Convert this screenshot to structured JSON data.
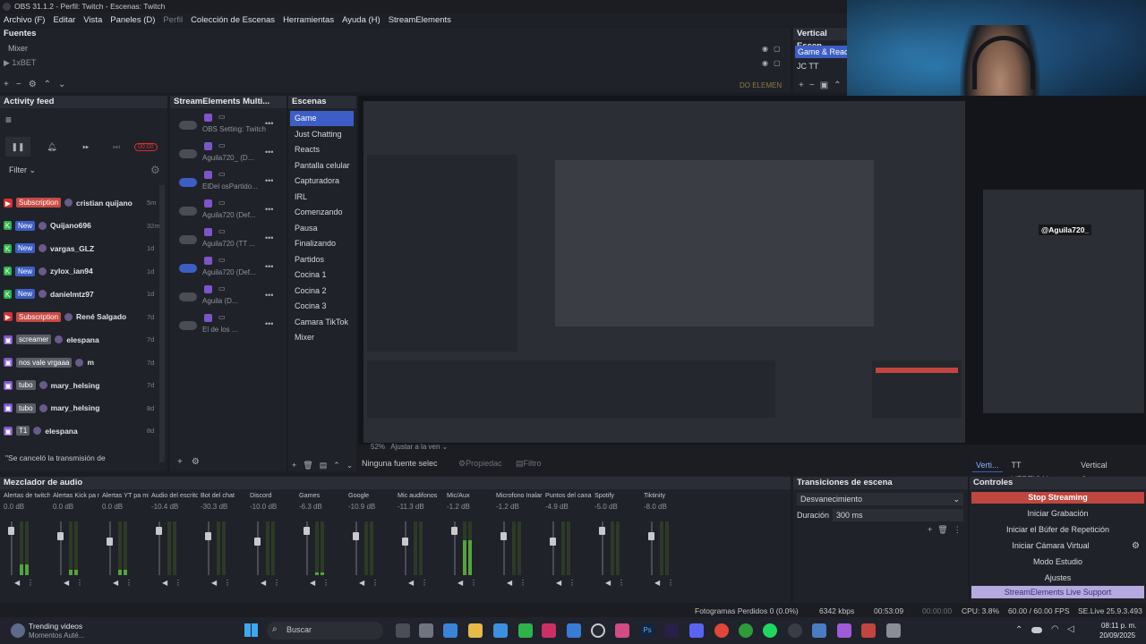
{
  "window": {
    "title": "OBS 31.1.2 - Perfil: Twitch - Escenas: Twitch"
  },
  "menu": [
    "Archivo (F)",
    "Editar",
    "Vista",
    "Paneles (D)",
    "Perfil",
    "Colección de Escenas",
    "Herramientas",
    "Ayuda (H)",
    "StreamElements"
  ],
  "sources": {
    "title": "Fuentes",
    "items": [
      "Mixer",
      "1xBET"
    ]
  },
  "vertical": {
    "title": "Vertical Escen",
    "items": [
      "Game & Reacts",
      "JC TT"
    ],
    "overlay_label": "DO ELEMEN"
  },
  "activity": {
    "title": "Activity feed",
    "filter_label": "Filter",
    "timer": "00:00",
    "rows": [
      {
        "tag": "Subscription",
        "tag_type": "sub",
        "name": "cristian quijano",
        "time": "5m"
      },
      {
        "tag": "New",
        "tag_type": "new",
        "platform": "kick",
        "name": "Quijano696",
        "time": "32m"
      },
      {
        "tag": "New",
        "tag_type": "new",
        "platform": "kick",
        "name": "vargas_GLZ",
        "time": "1d"
      },
      {
        "tag": "New",
        "tag_type": "new",
        "platform": "kick",
        "name": "zylox_ian94",
        "time": "1d"
      },
      {
        "tag": "New",
        "tag_type": "new",
        "platform": "kick",
        "name": "danielmtz97",
        "time": "1d"
      },
      {
        "tag": "Subscription",
        "tag_type": "sub",
        "name": "René Salgado",
        "time": "7d"
      },
      {
        "tag": "screamer",
        "tag_type": "gray",
        "name": "elespana",
        "time": "7d"
      },
      {
        "tag": "nos vale vrgaaa",
        "tag_type": "gray",
        "name": "m",
        "time": "7d"
      },
      {
        "tag": "tubo",
        "tag_type": "gray",
        "name": "mary_helsing",
        "time": "7d"
      },
      {
        "tag": "tubo",
        "tag_type": "gray",
        "name": "mary_helsing",
        "time": "8d"
      },
      {
        "tag": "T1",
        "tag_type": "gray",
        "name": "elespana",
        "time": "8d"
      }
    ],
    "footer": "\"Se canceló la transmisión de"
  },
  "se_multi": {
    "title": "StreamElements Multi...",
    "rows": [
      {
        "label": "OBS Setting: Twitch",
        "on": false
      },
      {
        "label": "Aguila720_ (D...",
        "on": false
      },
      {
        "label": "ElDel osPartido...",
        "on": true
      },
      {
        "label": "Aguila720 (Def...",
        "on": false
      },
      {
        "label": "Aguila720 (TT ...",
        "on": false
      },
      {
        "label": "Aguila720 (Def...",
        "on": true
      },
      {
        "label": "Aguila (D...",
        "on": false
      },
      {
        "label": "El de los ...",
        "on": false
      }
    ]
  },
  "scenes": {
    "title": "Escenas",
    "items": [
      "Game",
      "Just Chatting",
      "Reacts",
      "Pantalla celular",
      "Capturadora",
      "IRL",
      "Comenzando",
      "Pausa",
      "Finalizando",
      "Partidos",
      "Cocina 1",
      "Cocina 2",
      "Cocina 3",
      "Camara TikTok",
      "Mixer"
    ],
    "selected": "Game"
  },
  "preview": {
    "zoom": "52%",
    "adjust_label": "Ajustar a la ven",
    "no_source": "Ninguna fuente selec",
    "properties": "Propiedac",
    "filters": "Filtro"
  },
  "webcam": {
    "label": "@Aguila720_"
  },
  "vertical_tabs": [
    "Verti...",
    "TT VERTICAL...",
    "Vertical Canvas..."
  ],
  "mixer": {
    "title": "Mezclador de audio",
    "channels": [
      {
        "name": "Alertas de twitch",
        "db": "0.0 dB",
        "level": 0.2
      },
      {
        "name": "Alertas Kick pa m",
        "db": "0.0 dB",
        "level": 0.1
      },
      {
        "name": "Alertas YT pa mi",
        "db": "0.0 dB",
        "level": 0.1
      },
      {
        "name": "Audio del escrito",
        "db": "-10.4 dB",
        "level": 0.0
      },
      {
        "name": "Bot del chat",
        "db": "-30.3 dB",
        "level": 0.0
      },
      {
        "name": "Discord",
        "db": "-10.0 dB",
        "level": 0.0
      },
      {
        "name": "Games",
        "db": "-6.3 dB",
        "level": 0.05
      },
      {
        "name": "Google",
        "db": "-10.9 dB",
        "level": 0.0
      },
      {
        "name": "Mic audifonos",
        "db": "-11.3 dB",
        "level": 0.0
      },
      {
        "name": "Mic/Aux",
        "db": "-1.2 dB",
        "level": 0.65
      },
      {
        "name": "Microfono Inalar",
        "db": "-1.2 dB",
        "level": 0.0
      },
      {
        "name": "Puntos del canal",
        "db": "-4.9 dB",
        "level": 0.0
      },
      {
        "name": "Spotify",
        "db": "-5.0 dB",
        "level": 0.0
      },
      {
        "name": "Tiktinity",
        "db": "-8.0 dB",
        "level": 0.0
      }
    ]
  },
  "transitions": {
    "title": "Transiciones de escena",
    "type": "Desvanecimiento",
    "duration_label": "Duración",
    "duration": "300 ms"
  },
  "controls": {
    "title": "Controles",
    "stop_streaming": "Stop Streaming",
    "start_recording": "Iniciar Grabación",
    "replay_buffer": "Iniciar el Búfer de Repetición",
    "virtual_cam": "Iniciar Cámara Virtual",
    "studio_mode": "Modo Estudio",
    "settings": "Ajustes",
    "se_support": "StreamElements Live Support"
  },
  "status": {
    "dropped": "Fotogramas Perdidos 0 (0.0%)",
    "bitrate": "6342 kbps",
    "stream_time": "00:53:09",
    "rec_time": "00:00:00",
    "cpu": "CPU: 3.8%",
    "fps": "60.00 / 60.00 FPS",
    "se_version": "SE.Live 25.9.3.493"
  },
  "taskbar": {
    "news_title": "Trending videos",
    "news_sub": "Momentos Auté...",
    "search": "Buscar",
    "time": "08:11 p. m.",
    "date": "20/09/2025"
  },
  "colors": {
    "accent": "#3d5ec4",
    "stop_red": "#c0463f",
    "live_support": "#b6a9e0",
    "kick_green": "#2eb34a",
    "twitch_purple": "#7e55c9",
    "yt_red": "#d8302f"
  }
}
